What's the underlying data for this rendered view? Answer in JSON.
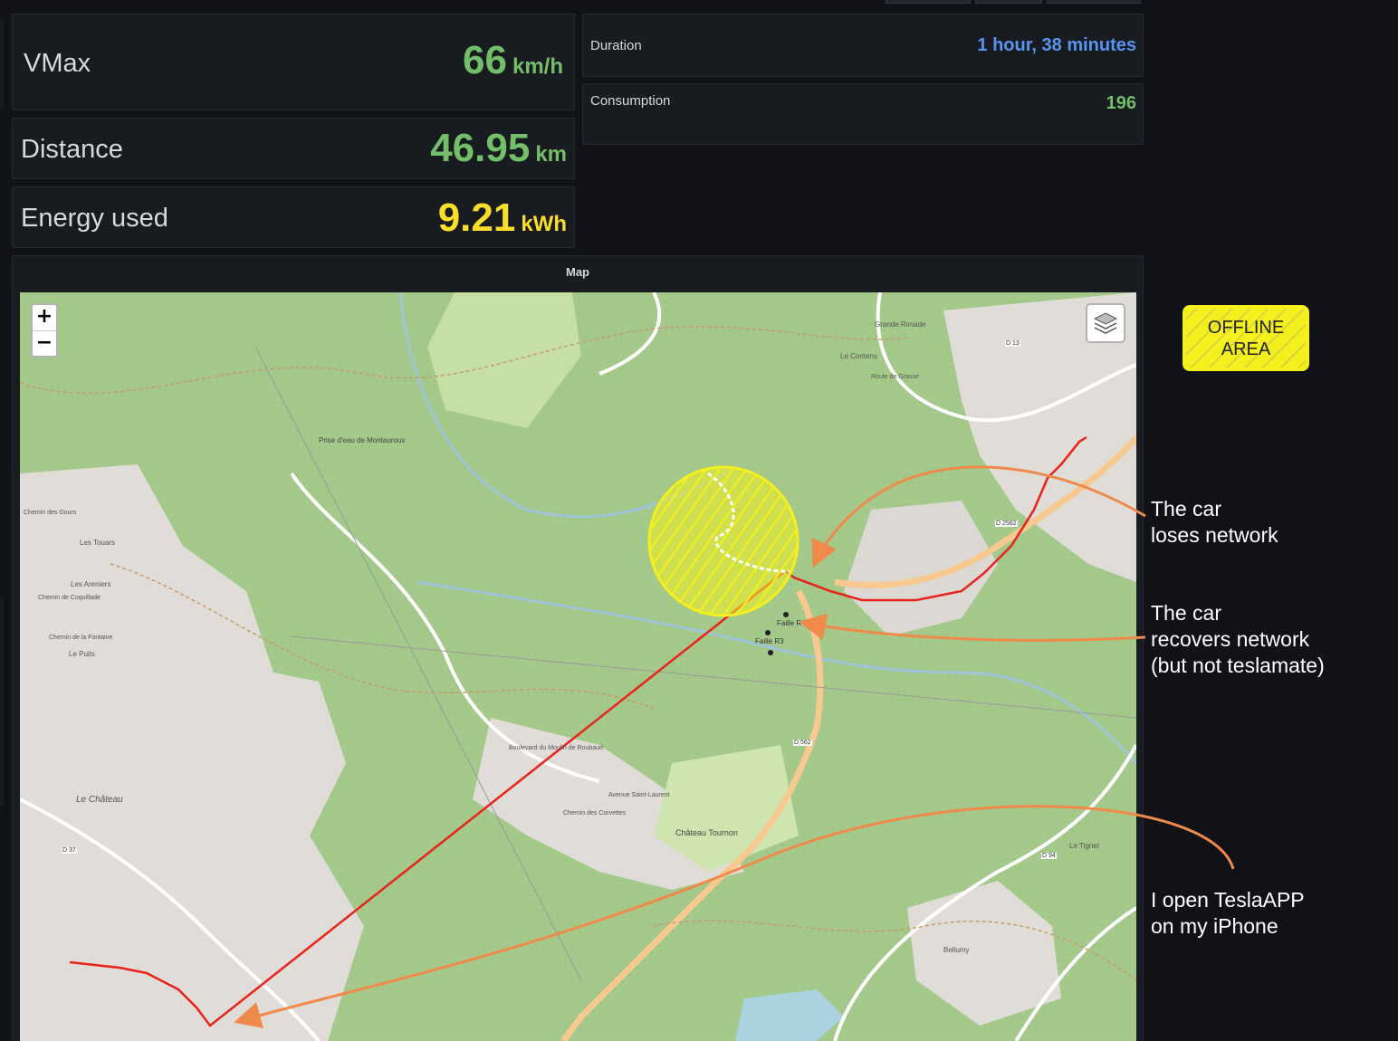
{
  "stats": {
    "vmax": {
      "label": "VMax",
      "value": "66",
      "unit": "km/h",
      "color": "#73bf69"
    },
    "distance": {
      "label": "Distance",
      "value": "46.95",
      "unit": "km",
      "color": "#73bf69"
    },
    "energy": {
      "label": "Energy used",
      "value": "9.21",
      "unit": "kWh",
      "color": "#fade2a"
    },
    "duration": {
      "label": "Duration",
      "value": "1 hour, 38 minutes",
      "color": "#5794f2"
    },
    "consumption": {
      "label": "Consumption",
      "value": "196",
      "color": "#73bf69"
    }
  },
  "map": {
    "title": "Map",
    "zoom_in": "+",
    "zoom_out": "−",
    "layers_icon": "layers-icon",
    "labels": [
      "Les Touars",
      "Les Areniers",
      "Le Puits",
      "Le Château",
      "Château Tournon",
      "Prise d'eau de Montauroux",
      "Grande Rimade",
      "Le Contens",
      "Faille R",
      "Faille R3",
      "Le Tignet",
      "Bellumy",
      "D 562",
      "D 94",
      "D 37",
      "D 13",
      "D 2562",
      "Chemin de Coquillade",
      "Chemin des Gours",
      "Chemin de la Fontaine",
      "Route de Grasse",
      "Boulevard du Moulin de Roubaud",
      "Avenue Saint-Laurent",
      "Chemin des Corvettes"
    ],
    "route_color": "#e8231b",
    "offline_color": "#f4f01e"
  },
  "annotations": {
    "offline_area": [
      "OFFLINE",
      "AREA"
    ],
    "loses_network": [
      "The car",
      "loses network"
    ],
    "recovers_network": [
      "The car",
      "recovers network",
      "(but not teslamate)"
    ],
    "open_app": [
      "I open TeslaAPP",
      "on my iPhone"
    ],
    "arrow_color": "#f08a4b"
  }
}
